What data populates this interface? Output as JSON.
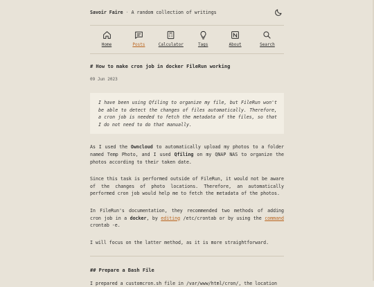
{
  "header": {
    "site_name": "Savoir Faire",
    "separator": "·",
    "tagline": "A random collection of writings"
  },
  "nav": [
    {
      "label": "Home",
      "icon": "home-icon"
    },
    {
      "label": "Posts",
      "icon": "posts-icon",
      "active": true
    },
    {
      "label": "Calculator",
      "icon": "calculator-icon"
    },
    {
      "label": "Tags",
      "icon": "tags-icon"
    },
    {
      "label": "About",
      "icon": "about-icon"
    },
    {
      "label": "Search",
      "icon": "search-icon"
    }
  ],
  "colors": {
    "accent": "#b8621b",
    "background": "#e8e3d8",
    "quote_bg": "#f2eee4"
  },
  "post": {
    "title": "# How to make cron job in docker FileRun working",
    "date": "09 Jun 2023",
    "quote": "I have been using Qfiling to organize my file, but FileRun won't be able to detect the changes of files automatically. Therefore, a cron job is needed to fetch the metadata of the files, so that I do not need to do that manually.",
    "p1": {
      "a": "As I used the ",
      "b": "Owncloud",
      "c": " to automatically upload my photos to a folder named Temp Photo, and I used ",
      "d": "Qfiling",
      "e": " on my QNAP NAS to organize the photos according to their taken date."
    },
    "p2": "Since this task is performed outside of FileRun, it would not be aware of the changes of photo locations. Therefore, an automatically performed cron job would help me to fetch the metadata of the photos.",
    "p3": {
      "a": "In FileRun's documentation, they recommended two methods of adding cron job in a ",
      "b": "docker",
      "c": ", by ",
      "link1": "editing",
      "d": " /etc/crontab or by using the ",
      "link2": "command",
      "e": " crontab -e."
    },
    "p4": "I will focus on the latter method, as it is more straightforward.",
    "h2": "## Prepare a Bash File",
    "p5": "I prepared a customcron.sh file in /var/www/html/cron/, the location"
  }
}
